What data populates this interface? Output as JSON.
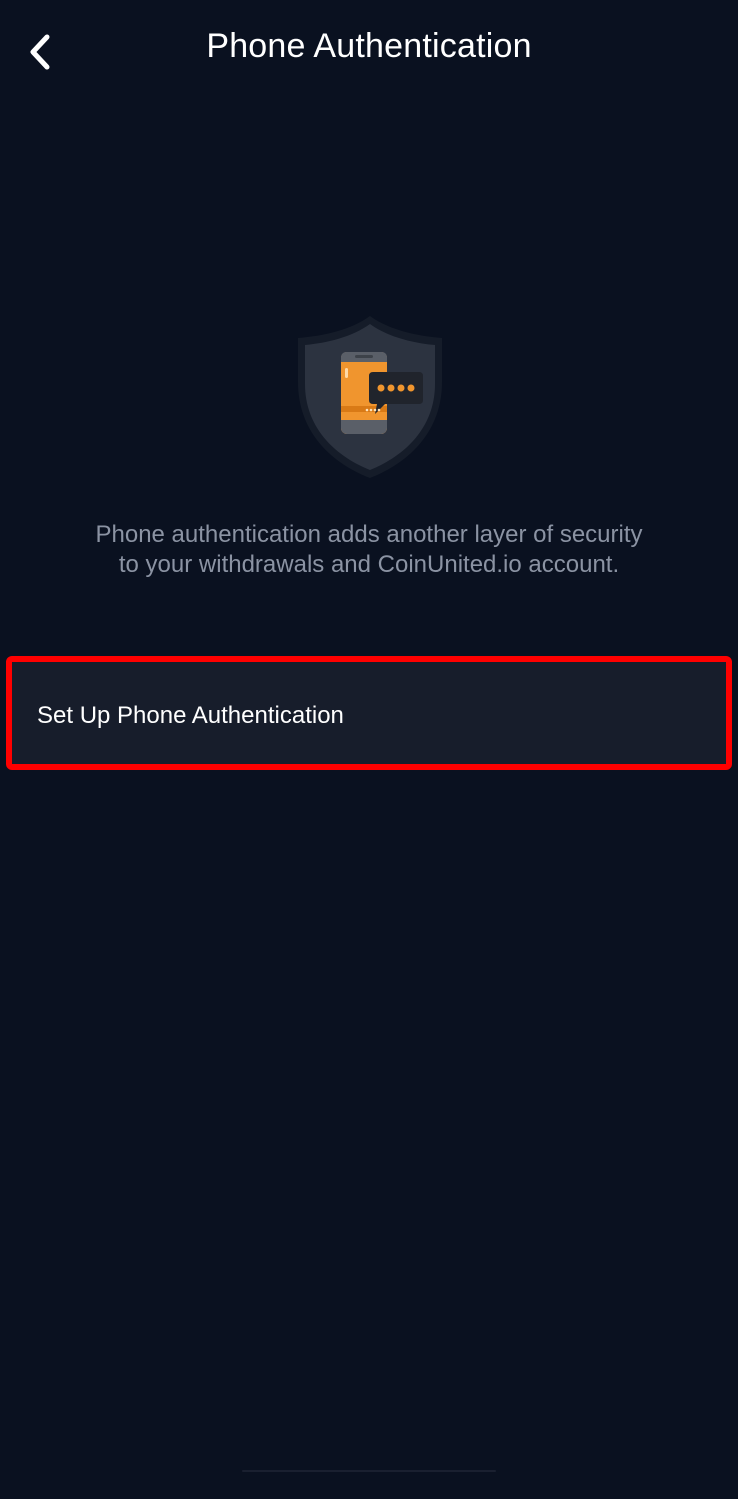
{
  "header": {
    "title": "Phone Authentication",
    "back_icon": "chevron-left-icon"
  },
  "hero": {
    "icon": "shield-phone-message-icon",
    "colors": {
      "shield": "#2c3340",
      "phone": "#f0952e",
      "bubble": "#20242c",
      "dots": "#f0952e"
    }
  },
  "description": {
    "line1": "Phone authentication adds another layer of security",
    "line2": "to your withdrawals and CoinUnited.io account."
  },
  "setup": {
    "label": "Set Up Phone Authentication",
    "highlight_color": "#ff0000"
  },
  "colors": {
    "background": "#0a1120",
    "item_background": "#171d2b",
    "text_primary": "#ffffff",
    "text_secondary": "#8b93a3"
  }
}
